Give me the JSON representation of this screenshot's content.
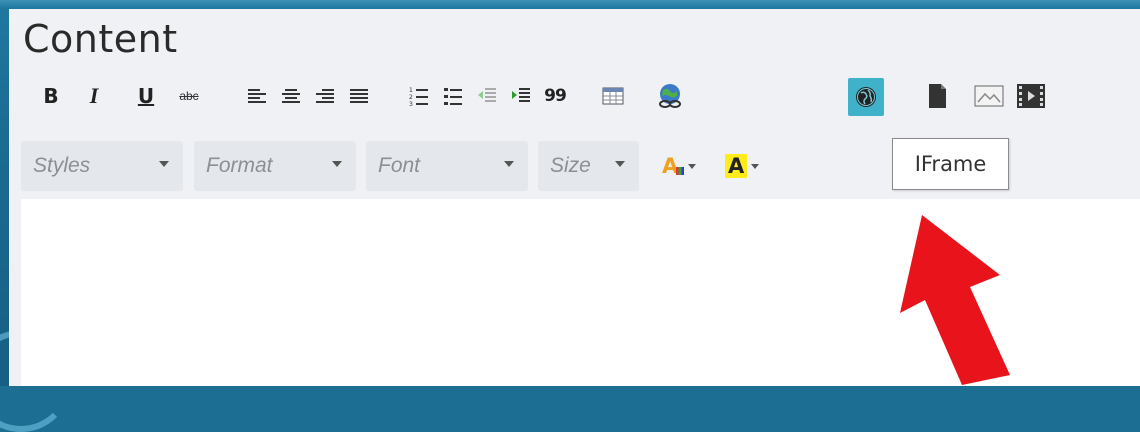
{
  "window": {
    "title": "Content"
  },
  "toolbar": {
    "buttons": [
      {
        "name": "bold-button",
        "label": "B"
      },
      {
        "name": "italic-button",
        "label": "I"
      },
      {
        "name": "underline-button",
        "label": "U"
      },
      {
        "name": "strikethrough-button",
        "label": "abc"
      },
      {
        "name": "align-left-button",
        "icon": "align-left-icon"
      },
      {
        "name": "align-center-button",
        "icon": "align-center-icon"
      },
      {
        "name": "align-right-button",
        "icon": "align-right-icon"
      },
      {
        "name": "justify-button",
        "icon": "justify-icon"
      },
      {
        "name": "numbered-list-button",
        "icon": "numbered-list-icon"
      },
      {
        "name": "bulleted-list-button",
        "icon": "bulleted-list-icon"
      },
      {
        "name": "outdent-button",
        "icon": "outdent-icon"
      },
      {
        "name": "indent-button",
        "icon": "indent-icon"
      },
      {
        "name": "blockquote-button",
        "label": "99"
      },
      {
        "name": "table-button",
        "icon": "table-icon"
      },
      {
        "name": "link-button",
        "icon": "globe-link-icon"
      },
      {
        "name": "iframe-button",
        "icon": "globe-icon",
        "active": true
      },
      {
        "name": "file-button",
        "icon": "file-icon"
      },
      {
        "name": "image-button",
        "icon": "image-icon"
      },
      {
        "name": "video-button",
        "icon": "video-icon"
      }
    ],
    "active_color": "#3fb2c9"
  },
  "combos": {
    "styles": "Styles",
    "format": "Format",
    "font": "Font",
    "size": "Size"
  },
  "color_buttons": {
    "text_color_letter": "A",
    "bg_color_letter": "A"
  },
  "tooltip": {
    "text": "IFrame"
  },
  "annotation": {
    "arrow_color": "#e8131b"
  }
}
